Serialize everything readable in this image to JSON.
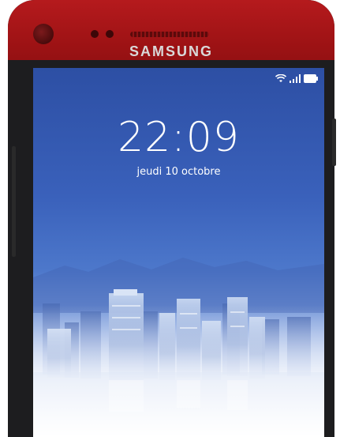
{
  "device": {
    "brand": "SAMSUNG",
    "body_color": "#a3151a"
  },
  "status_bar": {
    "icons": [
      "wifi-icon",
      "signal-icon",
      "battery-icon"
    ]
  },
  "lock_screen": {
    "time": "22:09",
    "date": "jeudi 10 octobre"
  }
}
